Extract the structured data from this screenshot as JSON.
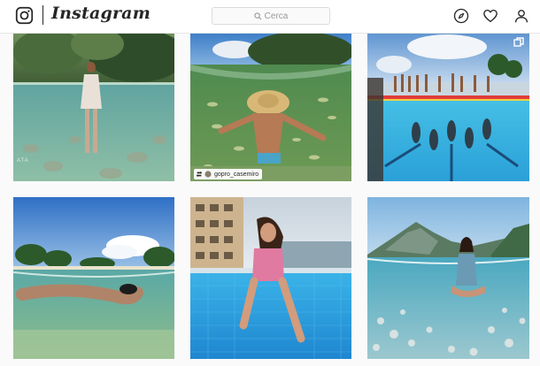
{
  "app": {
    "name": "Instagram",
    "logo_icon": "instagram-camera-icon"
  },
  "search": {
    "placeholder": "Cerca",
    "icon": "search-icon"
  },
  "nav_icons": [
    "explore-compass-icon",
    "heart-activity-icon",
    "profile-user-icon"
  ],
  "posts": [
    {
      "id": "post-1",
      "scene": "woman standing in clear shallow river, split over-under view",
      "overlay_text": "ATA"
    },
    {
      "id": "post-2",
      "scene": "man in straw hat snorkeling among fish in clear water",
      "repost_user": "gopro_casemiro",
      "repost_icon": "repost-icon"
    },
    {
      "id": "post-3",
      "scene": "swimmers in outdoor pool seen over-under, crowd on edge",
      "multi_icon": "carousel-icon"
    },
    {
      "id": "post-4",
      "scene": "swimmer gliding underwater near tropical beach with palms"
    },
    {
      "id": "post-5",
      "scene": "woman sitting on edge of hotel pool, legs in water"
    },
    {
      "id": "post-6",
      "scene": "woman sitting on pebble seabed, mountains behind, split view"
    }
  ],
  "colors": {
    "topbar_bg": "#ffffff",
    "page_bg": "#fafafa",
    "border": "#dbdbdb",
    "text": "#262626",
    "placeholder": "#999999"
  }
}
